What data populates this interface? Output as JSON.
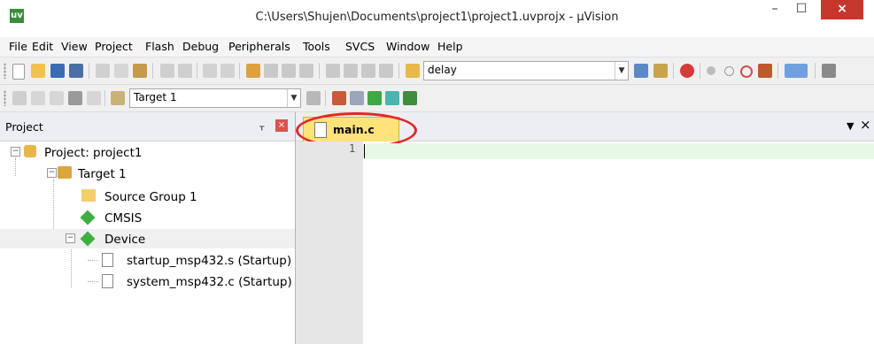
{
  "window": {
    "title": "C:\\Users\\Shujen\\Documents\\project1\\project1.uvprojx - µVision",
    "app_icon": "uv",
    "min_glyph": "–",
    "max_glyph": "☐",
    "close_glyph": "×"
  },
  "menu": [
    "File",
    "Edit",
    "View",
    "Project",
    "Flash",
    "Debug",
    "Peripherals",
    "Tools",
    "SVCS",
    "Window",
    "Help"
  ],
  "toolbar1": {
    "find_combo_value": "delay"
  },
  "toolbar2": {
    "target_combo_value": "Target 1"
  },
  "project_panel": {
    "title": "Project",
    "pin_glyph": "ᚁ",
    "close_glyph": "×",
    "tree": {
      "project": "Project: project1",
      "target": "Target 1",
      "source_group": "Source Group 1",
      "cmsis": "CMSIS",
      "device": "Device",
      "file1": "startup_msp432.s (Startup)",
      "file2": "system_msp432.c (Startup)"
    },
    "expand_minus": "−"
  },
  "editor": {
    "tab_label": "main.c",
    "line_number": "1",
    "tab_menu_glyph": "▼",
    "tab_close_glyph": "×"
  },
  "colors": {
    "tab_bg": "#ffe27a",
    "highlight_ellipse": "#e2272c",
    "current_line": "#e8f8e6",
    "close_button": "#c7362c"
  }
}
